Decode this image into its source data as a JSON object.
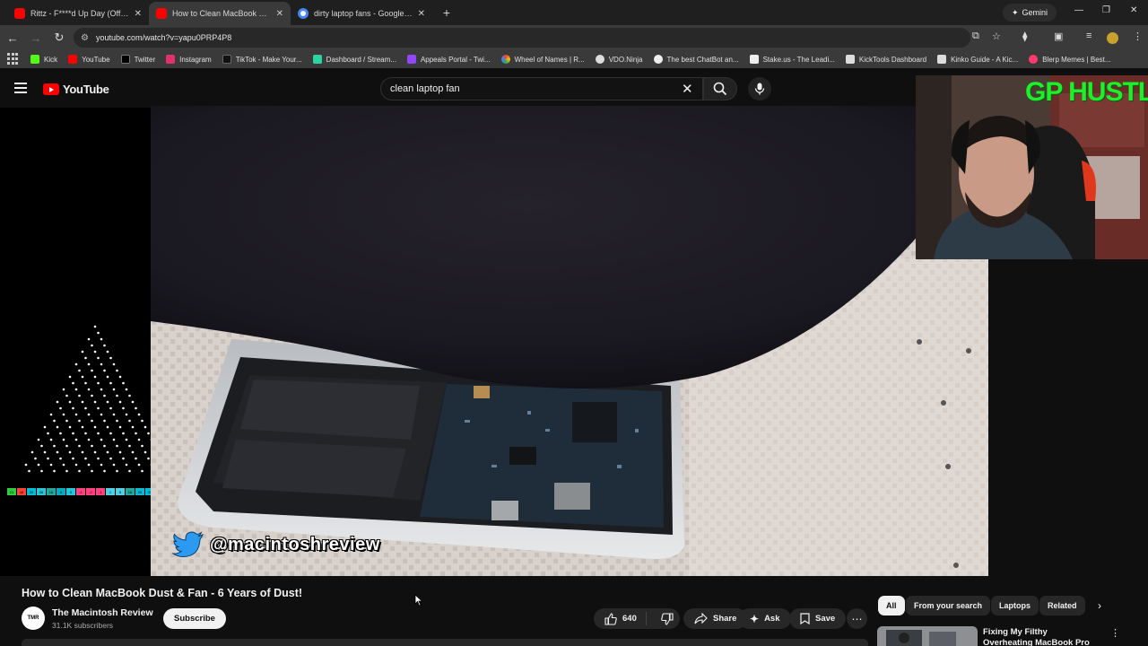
{
  "browser": {
    "tabs": [
      {
        "title": "Rittz - F****d Up Day (Official M",
        "favicon_color": "#ff0000"
      },
      {
        "title": "How to Clean MacBook Dust &",
        "favicon_color": "#ff0000"
      },
      {
        "title": "dirty laptop fans - Google Sear",
        "favicon_color": "#4285f4"
      }
    ],
    "new_tab": "+",
    "gemini_label": "Gemini",
    "url": "youtube.com/watch?v=yapu0PRP4P8",
    "bookmarks": [
      {
        "label": "Kick",
        "color": "#53fc18"
      },
      {
        "label": "YouTube",
        "color": "#ff0000"
      },
      {
        "label": "Twitter",
        "color": "#000000"
      },
      {
        "label": "Instagram",
        "color": "#e1306c"
      },
      {
        "label": "TikTok - Make Your...",
        "color": "#111111"
      },
      {
        "label": "Dashboard / Stream...",
        "color": "#2bd5a1"
      },
      {
        "label": "Appeals Portal - Twi...",
        "color": "#9146ff"
      },
      {
        "label": "Wheel of Names | R...",
        "color": "#4285f4"
      },
      {
        "label": "VDO.Ninja",
        "color": "#dddddd"
      },
      {
        "label": "The best ChatBot an...",
        "color": "#eeeeee"
      },
      {
        "label": "Stake.us - The Leadi...",
        "color": "#eeeeee"
      },
      {
        "label": "KickTools Dashboard",
        "color": "#dddddd"
      },
      {
        "label": "Kinko Guide - A Kic...",
        "color": "#dddddd"
      },
      {
        "label": "Blerp Memes | Best...",
        "color": "#ff3b6b"
      }
    ]
  },
  "youtube": {
    "logo_text": "YouTube",
    "search_query": "clean laptop fan"
  },
  "video": {
    "watermark_handle": "@macintoshreview",
    "title": "How to Clean MacBook Dust & Fan - 6 Years of Dust!",
    "channel_name": "The Macintosh Review",
    "channel_avatar_text": "TMR",
    "subscribers": "31.1K subscribers",
    "subscribe_label": "Subscribe",
    "likes": "640",
    "share_label": "Share",
    "ask_label": "Ask",
    "save_label": "Save"
  },
  "webcam_overlay": {
    "brand_text": "GP HUSTLA"
  },
  "chat_counters": [
    "21",
    "48",
    "35",
    "26",
    "16",
    "8",
    "0",
    "-1",
    "-2",
    "-1",
    "1",
    "5",
    "16",
    "26",
    "35",
    "48",
    "100"
  ],
  "chips": [
    "All",
    "From your search",
    "Laptops",
    "Related"
  ],
  "recommendation": {
    "title": "Fixing My Filthy Overheating MacBook Pro"
  }
}
